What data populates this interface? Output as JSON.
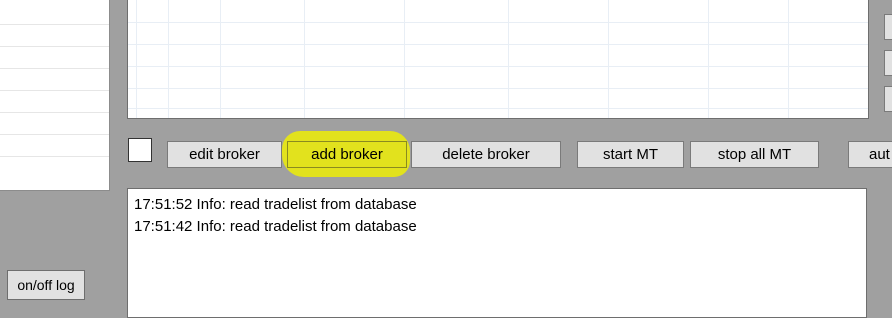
{
  "toolbar": {
    "edit_broker": "edit broker",
    "add_broker": "add broker",
    "delete_broker": "delete broker",
    "start_mt": "start MT",
    "stop_all_mt": "stop all MT",
    "auto_partial": "aut"
  },
  "log": {
    "lines": [
      "17:51:52 Info: read tradelist from database",
      "17:51:42 Info: read tradelist from database"
    ],
    "toggle_label": "on/off log"
  },
  "annotation": {
    "highlight_color": "#f0f000"
  }
}
